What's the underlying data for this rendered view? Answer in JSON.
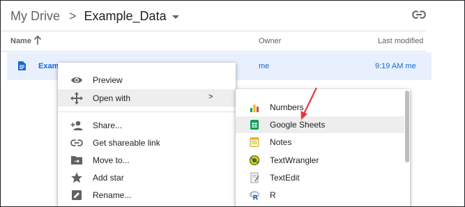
{
  "breadcrumb": {
    "root": "My Drive",
    "separator": ">",
    "current": "Example_Data"
  },
  "columns": {
    "name": "Name",
    "owner": "Owner",
    "last_modified": "Last modified"
  },
  "file": {
    "name": "Exam",
    "owner": "me",
    "modified": "9:19 AM  me",
    "icon": "doc-icon"
  },
  "context_menu": {
    "items": [
      {
        "label": "Preview",
        "icon": "eye-icon"
      },
      {
        "label": "Open with",
        "icon": "move-arrows-icon",
        "submenu_arrow": ">"
      },
      {
        "label": "Share...",
        "icon": "person-add-icon"
      },
      {
        "label": "Get shareable link",
        "icon": "link-icon"
      },
      {
        "label": "Move to...",
        "icon": "folder-move-icon"
      },
      {
        "label": "Add star",
        "icon": "star-icon"
      },
      {
        "label": "Rename...",
        "icon": "pencil-icon"
      }
    ]
  },
  "open_with_menu": {
    "items": [
      {
        "label": "Numbers",
        "icon": "numbers-icon"
      },
      {
        "label": "Google Sheets",
        "icon": "sheets-icon"
      },
      {
        "label": "Notes",
        "icon": "notes-icon"
      },
      {
        "label": "TextWrangler",
        "icon": "textwrangler-icon"
      },
      {
        "label": "TextEdit",
        "icon": "textedit-icon"
      },
      {
        "label": "R",
        "icon": "r-icon"
      }
    ]
  },
  "colors": {
    "accent": "#1967d2",
    "selected_row": "#e8f0fe",
    "sheets_green": "#0f9d58",
    "annotation_red": "#e53935"
  }
}
